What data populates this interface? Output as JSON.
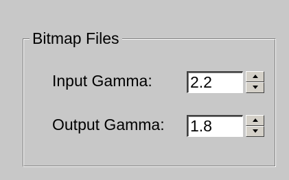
{
  "group": {
    "title": "Bitmap Files"
  },
  "fields": [
    {
      "label": "Input Gamma:",
      "value": "2.2"
    },
    {
      "label": "Output Gamma:",
      "value": "1.8"
    }
  ],
  "icons": {
    "spin_up": "arrow-up-icon",
    "spin_down": "arrow-down-icon"
  }
}
